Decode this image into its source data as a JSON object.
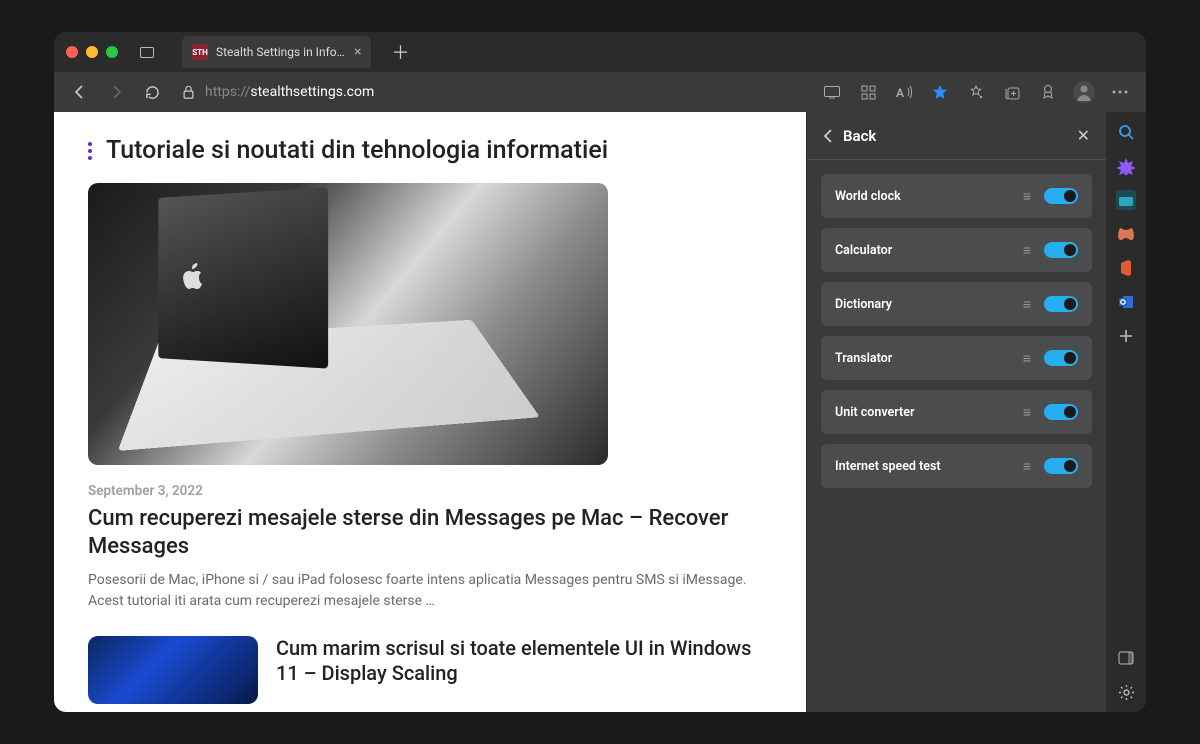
{
  "tab": {
    "title": "Stealth Settings in Information",
    "favicon_text": "STH"
  },
  "address": {
    "prefix": "https://",
    "domain": "stealthsettings.com"
  },
  "page": {
    "heading": "Tutoriale si noutati din tehnologia informatiei",
    "article1": {
      "date": "September 3, 2022",
      "title": "Cum recuperezi mesajele sterse din Messages pe Mac – Recover Messages",
      "excerpt": "Posesorii de Mac, iPhone si / sau iPad folosesc foarte intens aplicatia Messages pentru SMS si iMessage. Acest tutorial iti arata cum recuperezi mesajele sterse …"
    },
    "article2": {
      "title": "Cum marim scrisul si toate elementele UI in Windows 11 – Display Scaling"
    }
  },
  "panel": {
    "back": "Back",
    "tools": [
      {
        "label": "World clock",
        "on": true
      },
      {
        "label": "Calculator",
        "on": true
      },
      {
        "label": "Dictionary",
        "on": true
      },
      {
        "label": "Translator",
        "on": true
      },
      {
        "label": "Unit converter",
        "on": true
      },
      {
        "label": "Internet speed test",
        "on": true
      }
    ]
  }
}
